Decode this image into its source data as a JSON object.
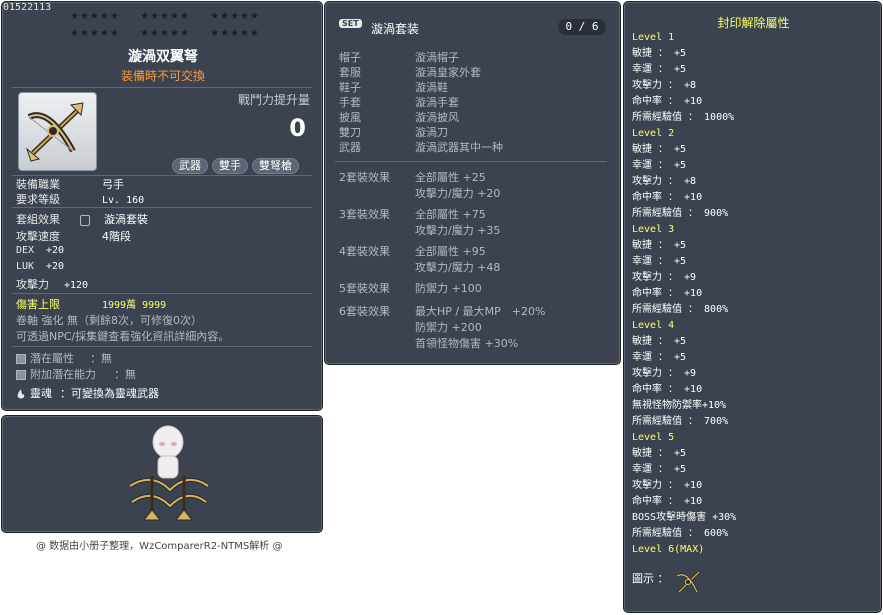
{
  "item": {
    "id": "01522113",
    "stars_row1": [
      "★★★★★",
      "★★★★★",
      "★★★★★"
    ],
    "stars_row2": [
      "★★★★★",
      "★★★★★",
      "★★★★★"
    ],
    "name": "漩渦双翼弩",
    "trade_note": "装備時不可交換",
    "combat_power_label": "戰鬥力提升量",
    "combat_power_value": "0",
    "tags": [
      "武器",
      "雙手",
      "雙弩槍"
    ],
    "job_label": "裝備職業",
    "job_value": "弓手",
    "level_label": "要求等級",
    "level_value": "Lv. 160",
    "set_label": "套組效果",
    "set_value": "漩渦套裝",
    "speed_label": "攻擊速度",
    "speed_value": "4階段",
    "stat1_label": "DEX",
    "stat1_value": "+20",
    "stat2_label": "LUK",
    "stat2_value": "+20",
    "stat3_label": "攻擊力",
    "stat3_value": "+120",
    "damage_cap_label": "傷害上限",
    "damage_cap_value": "1999萬 9999",
    "scroll_line": "卷軸 強化 無（剩餘8次，可修復0次）",
    "npc_line": "可透過NPC/採集鍵查看強化資訊詳細內容。",
    "potential_label": "潛在屬性",
    "potential_value": "：無",
    "bonus_potential_label": "附加潛在能力",
    "bonus_potential_value": "：無",
    "soul_label": "靈魂",
    "soul_value": "：可變換為靈魂武器"
  },
  "footer_note": "@ 数据由小册子整理，WzComparerR2-NTMS解析 @",
  "set": {
    "badge": "SET",
    "title": "漩渦套装",
    "count": "0 / 6",
    "parts": [
      {
        "slot": "帽子",
        "name": "漩渦帽子"
      },
      {
        "slot": "套服",
        "name": "漩渦皇家外套"
      },
      {
        "slot": "鞋子",
        "name": "漩渦鞋"
      },
      {
        "slot": "手套",
        "name": "漩渦手套"
      },
      {
        "slot": "披風",
        "name": "漩渦披风"
      },
      {
        "slot": "雙刀",
        "name": "漩渦刀"
      },
      {
        "slot": "武器",
        "name": "漩渦武器其中一种"
      }
    ],
    "effects": [
      {
        "label": "2套裝效果",
        "lines": [
          "全部屬性 +25",
          "攻擊力/魔力 +20"
        ]
      },
      {
        "label": "3套裝效果",
        "lines": [
          "全部屬性 +75",
          "攻擊力/魔力 +35"
        ]
      },
      {
        "label": "4套裝效果",
        "lines": [
          "全部屬性 +95",
          "攻擊力/魔力 +48"
        ]
      },
      {
        "label": "5套裝效果",
        "lines": [
          "防禦力 +100"
        ]
      },
      {
        "label": "6套裝效果",
        "lines": [
          "最大HP / 最大MP　+20%",
          "防禦力 +200",
          "首領怪物傷害 +30%"
        ]
      }
    ]
  },
  "seal": {
    "title": "封印解除屬性",
    "levels": [
      {
        "name": "Level 1",
        "stats": [
          "敏捷 ： +5",
          "幸運 ： +5",
          "攻擊力 ： +8",
          "命中率 ： +10",
          "所需經驗值 ： 1000%"
        ]
      },
      {
        "name": "Level 2",
        "stats": [
          "敏捷 ： +5",
          "幸運 ： +5",
          "攻擊力 ： +8",
          "命中率 ： +10",
          "所需經驗值 ： 900%"
        ]
      },
      {
        "name": "Level 3",
        "stats": [
          "敏捷 ： +5",
          "幸運 ： +5",
          "攻擊力 ： +9",
          "命中率 ： +10",
          "所需經驗值 ： 800%"
        ]
      },
      {
        "name": "Level 4",
        "stats": [
          "敏捷 ： +5",
          "幸運 ： +5",
          "攻擊力 ： +9",
          "命中率 ： +10",
          "無視怪物防禦率+10%",
          "所需經驗值 ： 700%"
        ]
      },
      {
        "name": "Level 5",
        "stats": [
          "敏捷 ： +5",
          "幸運 ： +5",
          "攻擊力 ： +10",
          "命中率 ： +10",
          "BOSS攻擊時傷害 +30%",
          "所需經驗值 ： 600%"
        ]
      },
      {
        "name": "Level 6(MAX)",
        "stats": []
      }
    ],
    "picture_label": "圖示 ："
  },
  "colors": {
    "panel_bg": "#3b4350",
    "highlight_yellow": "#ffff66",
    "orange": "#ff9a3c"
  }
}
